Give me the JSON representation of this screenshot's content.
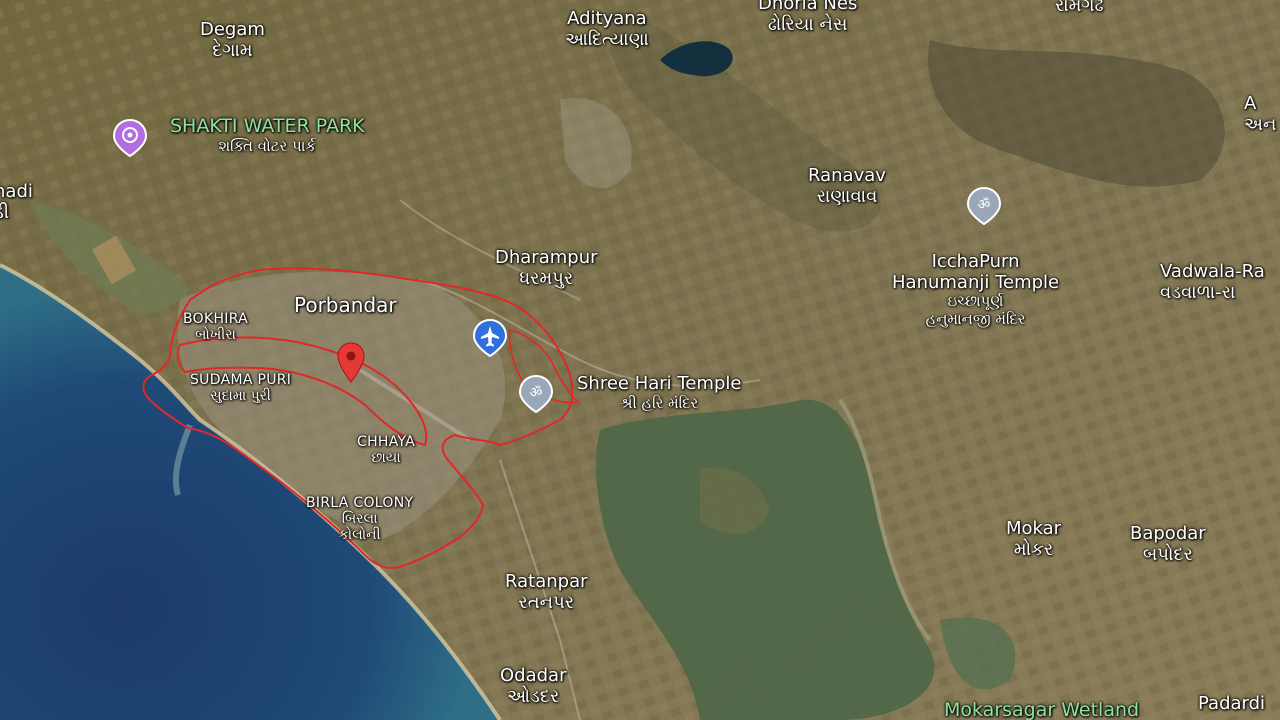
{
  "map": {
    "type": "satellite",
    "colors": {
      "sea_deep": "#1d3d6e",
      "sea_shallow": "#2d6d88",
      "land": "#7d7150",
      "wetland": "#4f6a4a",
      "outline": "#e02828",
      "pin_red": "#e53935",
      "pin_blue": "#2f6fde",
      "pin_gray": "#9aa7b8",
      "pin_purple": "#b46de0"
    },
    "places": {
      "degam": {
        "en": "Degam",
        "gu": "દેગામ"
      },
      "adityana": {
        "en": "Adityana",
        "gu": "આદિત્યાણા"
      },
      "dhoria": {
        "en": "Dhoria Nes",
        "gu": "ઢોરિયા નેસ"
      },
      "ramgadh": {
        "en": "",
        "gu": "રામગઢ"
      },
      "shakti": {
        "en": "SHAKTI WATER PARK",
        "gu": "શક્તિ વોટર પાર્ક"
      },
      "hadi": {
        "en": "hadi",
        "gu": "ડી"
      },
      "ranavav": {
        "en": "Ranavav",
        "gu": "રાણાવાવ"
      },
      "icchapurn": {
        "en1": "IcchaPurn",
        "en2": "Hanumanji Temple",
        "gu1": "ઇચ્છાપૂર્ણ",
        "gu2": "હનુમાનજી મંદિર"
      },
      "dharampur": {
        "en": "Dharampur",
        "gu": "ધરમપુર"
      },
      "vadwala": {
        "en": "Vadwala-Ra",
        "gu": "વડવાળા-રા"
      },
      "porbandar": {
        "en": "Porbandar"
      },
      "bokhira": {
        "en": "BOKHIRA",
        "gu": "બોખીરા"
      },
      "sudamapuri": {
        "en": "SUDAMA PURI",
        "gu": "સુદામા પુરી"
      },
      "shreehari": {
        "en": "Shree Hari Temple",
        "gu": "શ્રી હરિ મંદિર"
      },
      "chhaya": {
        "en": "CHHAYA",
        "gu": "છાયા"
      },
      "birla": {
        "en": "BIRLA COLONY",
        "gu1": "બિરલા",
        "gu2": "કોલોની"
      },
      "mokar": {
        "en": "Mokar",
        "gu": "મોકર"
      },
      "bapodar": {
        "en": "Bapodar",
        "gu": "બપોદર"
      },
      "ratanpar": {
        "en": "Ratanpar",
        "gu": "રતનપર"
      },
      "odadar": {
        "en": "Odadar",
        "gu": "ઓડદર"
      },
      "mokarsagar": {
        "en": "Mokarsagar Wetland"
      },
      "padardi": {
        "en": "Padardi"
      },
      "anedge": {
        "en": "A",
        "gu": "અન"
      }
    },
    "markers": {
      "shakti_icon": "water-park-icon",
      "airport_icon": "airplane-icon",
      "temple_icon": "om-icon",
      "location_icon": "location-pin-icon"
    }
  }
}
